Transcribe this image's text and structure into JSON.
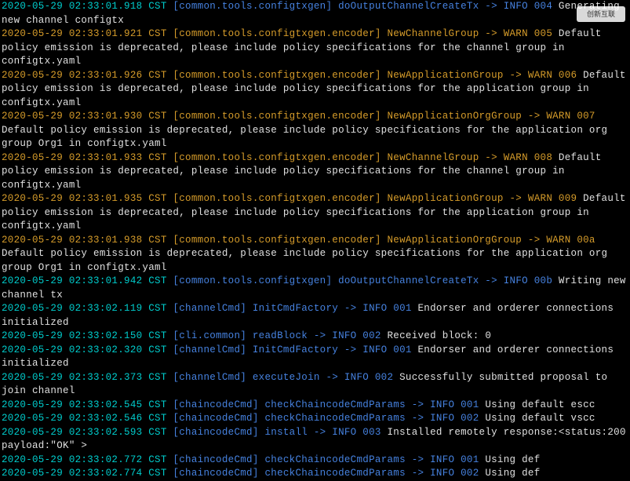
{
  "watermark": "创新互联",
  "log_lines": [
    {
      "ts": "2020-05-29 02:33:01.918 CST ",
      "ts_class": "cyan",
      "src": "[common.tools.configtxgen] ",
      "src_class": "blue",
      "evt": "doOutputChannelCreateTx -> INFO 004 ",
      "evt_class": "blue",
      "msg": "Generating new channel configtx",
      "msg_class": "white"
    },
    {
      "ts": "2020-05-29 02:33:01.921 CST ",
      "ts_class": "orange",
      "src": "[common.tools.configtxgen.encoder] ",
      "src_class": "orange",
      "evt": "NewChannelGroup -> WARN 005 ",
      "evt_class": "orange",
      "msg": "Default policy emission is deprecated, please include policy specifications for the channel group in configtx.yaml",
      "msg_class": "white"
    },
    {
      "ts": "2020-05-29 02:33:01.926 CST ",
      "ts_class": "orange",
      "src": "[common.tools.configtxgen.encoder] ",
      "src_class": "orange",
      "evt": "NewApplicationGroup -> WARN 006 ",
      "evt_class": "orange",
      "msg": "Default policy emission is deprecated, please include policy specifications for the application group in configtx.yaml",
      "msg_class": "white"
    },
    {
      "ts": "2020-05-29 02:33:01.930 CST ",
      "ts_class": "orange",
      "src": "[common.tools.configtxgen.encoder] ",
      "src_class": "orange",
      "evt": "NewApplicationOrgGroup -> WARN 007 ",
      "evt_class": "orange",
      "msg": "Default policy emission is deprecated, please include policy specifications for the application org group Org1 in configtx.yaml",
      "msg_class": "white"
    },
    {
      "ts": "2020-05-29 02:33:01.933 CST ",
      "ts_class": "orange",
      "src": "[common.tools.configtxgen.encoder] ",
      "src_class": "orange",
      "evt": "NewChannelGroup -> WARN 008 ",
      "evt_class": "orange",
      "msg": "Default policy emission is deprecated, please include policy specifications for the channel group in configtx.yaml",
      "msg_class": "white"
    },
    {
      "ts": "2020-05-29 02:33:01.935 CST ",
      "ts_class": "orange",
      "src": "[common.tools.configtxgen.encoder] ",
      "src_class": "orange",
      "evt": "NewApplicationGroup -> WARN 009 ",
      "evt_class": "orange",
      "msg": "Default policy emission is deprecated, please include policy specifications for the application group in configtx.yaml",
      "msg_class": "white"
    },
    {
      "ts": "2020-05-29 02:33:01.938 CST ",
      "ts_class": "orange",
      "src": "[common.tools.configtxgen.encoder] ",
      "src_class": "orange",
      "evt": "NewApplicationOrgGroup -> WARN 00a ",
      "evt_class": "orange",
      "msg": "Default policy emission is deprecated, please include policy specifications for the application org group Org1 in configtx.yaml",
      "msg_class": "white"
    },
    {
      "ts": "2020-05-29 02:33:01.942 CST ",
      "ts_class": "cyan",
      "src": "[common.tools.configtxgen] ",
      "src_class": "blue",
      "evt": "doOutputChannelCreateTx -> INFO 00b ",
      "evt_class": "blue",
      "msg": "Writing new channel tx",
      "msg_class": "white"
    },
    {
      "ts": "2020-05-29 02:33:02.119 CST ",
      "ts_class": "cyan",
      "src": "[channelCmd] ",
      "src_class": "blue",
      "evt": "InitCmdFactory -> INFO 001 ",
      "evt_class": "blue",
      "msg": "Endorser and orderer connections initialized",
      "msg_class": "white"
    },
    {
      "ts": "2020-05-29 02:33:02.150 CST ",
      "ts_class": "cyan",
      "src": "[cli.common] ",
      "src_class": "blue",
      "evt": "readBlock -> INFO 002 ",
      "evt_class": "blue",
      "msg": "Received block: 0",
      "msg_class": "white"
    },
    {
      "ts": "2020-05-29 02:33:02.320 CST ",
      "ts_class": "cyan",
      "src": "[channelCmd] ",
      "src_class": "blue",
      "evt": "InitCmdFactory -> INFO 001 ",
      "evt_class": "blue",
      "msg": "Endorser and orderer connections initialized",
      "msg_class": "white"
    },
    {
      "ts": "2020-05-29 02:33:02.373 CST ",
      "ts_class": "cyan",
      "src": "[channelCmd] ",
      "src_class": "blue",
      "evt": "executeJoin -> INFO 002 ",
      "evt_class": "blue",
      "msg": "Successfully submitted proposal to join channel",
      "msg_class": "white"
    },
    {
      "ts": "2020-05-29 02:33:02.545 CST ",
      "ts_class": "cyan",
      "src": "[chaincodeCmd] ",
      "src_class": "blue",
      "evt": "checkChaincodeCmdParams -> INFO 001 ",
      "evt_class": "blue",
      "msg": "Using default escc",
      "msg_class": "white"
    },
    {
      "ts": "2020-05-29 02:33:02.546 CST ",
      "ts_class": "cyan",
      "src": "[chaincodeCmd] ",
      "src_class": "blue",
      "evt": "checkChaincodeCmdParams -> INFO 002 ",
      "evt_class": "blue",
      "msg": "Using default vscc",
      "msg_class": "white"
    },
    {
      "ts": "2020-05-29 02:33:02.593 CST ",
      "ts_class": "cyan",
      "src": "[chaincodeCmd] ",
      "src_class": "blue",
      "evt": "install -> INFO 003 ",
      "evt_class": "blue",
      "msg": "Installed remotely response:<status:200 payload:\"OK\" >",
      "msg_class": "white"
    },
    {
      "ts": "2020-05-29 02:33:02.772 CST ",
      "ts_class": "cyan",
      "src": "[chaincodeCmd] ",
      "src_class": "blue",
      "evt": "checkChaincodeCmdParams -> INFO 001 ",
      "evt_class": "blue",
      "msg": "Using def",
      "msg_class": "white"
    },
    {
      "ts": "2020-05-29 02:33:02.774 CST ",
      "ts_class": "cyan",
      "src": "[chaincodeCmd] ",
      "src_class": "blue",
      "evt": "checkChaincodeCmdParams -> INFO 002 ",
      "evt_class": "blue",
      "msg": "Using def",
      "msg_class": "white"
    }
  ]
}
